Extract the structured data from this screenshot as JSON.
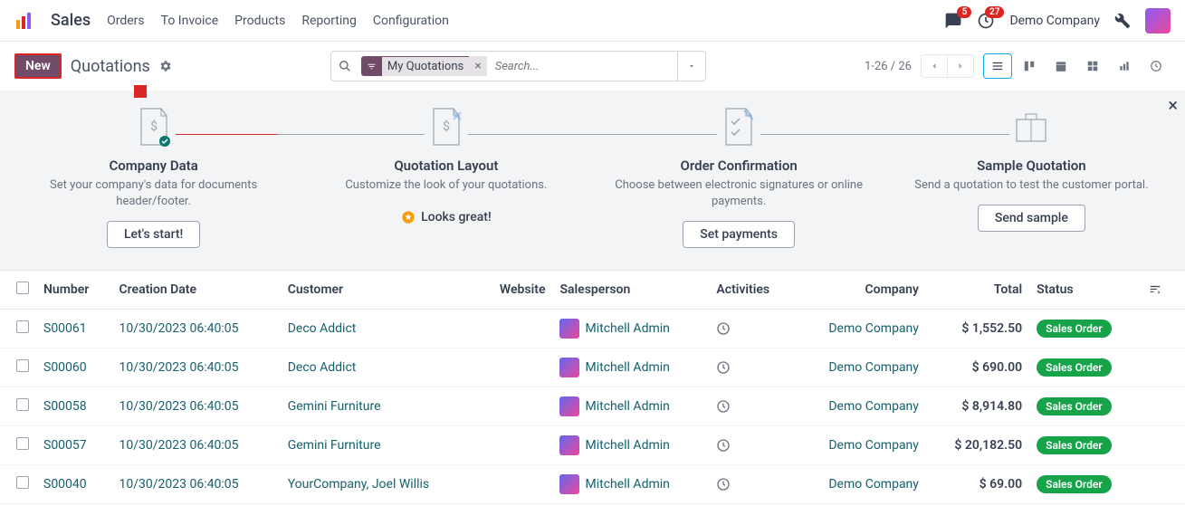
{
  "navbar": {
    "app_name": "Sales",
    "menu": [
      "Orders",
      "To Invoice",
      "Products",
      "Reporting",
      "Configuration"
    ],
    "chat_badge": "5",
    "activity_badge": "27",
    "company": "Demo Company"
  },
  "toolbar": {
    "new_label": "New",
    "breadcrumb": "Quotations",
    "filter_label": "My Quotations",
    "search_placeholder": "Search...",
    "pager": "1-26 / 26"
  },
  "onboarding": {
    "steps": [
      {
        "title": "Company Data",
        "desc": "Set your company's data for documents header/footer.",
        "btn": "Let's start!"
      },
      {
        "title": "Quotation Layout",
        "desc": "Customize the look of your quotations.",
        "btn": "Looks great!"
      },
      {
        "title": "Order Confirmation",
        "desc": "Choose between electronic signatures or online payments.",
        "btn": "Set payments"
      },
      {
        "title": "Sample Quotation",
        "desc": "Send a quotation to test the customer portal.",
        "btn": "Send sample"
      }
    ]
  },
  "table": {
    "headers": {
      "number": "Number",
      "creation": "Creation Date",
      "customer": "Customer",
      "website": "Website",
      "salesperson": "Salesperson",
      "activities": "Activities",
      "company": "Company",
      "total": "Total",
      "status": "Status"
    },
    "rows": [
      {
        "number": "S00061",
        "date": "10/30/2023 06:40:05",
        "customer": "Deco Addict",
        "salesperson": "Mitchell Admin",
        "company": "Demo Company",
        "total": "$ 1,552.50",
        "status": "Sales Order"
      },
      {
        "number": "S00060",
        "date": "10/30/2023 06:40:05",
        "customer": "Deco Addict",
        "salesperson": "Mitchell Admin",
        "company": "Demo Company",
        "total": "$ 690.00",
        "status": "Sales Order"
      },
      {
        "number": "S00058",
        "date": "10/30/2023 06:40:05",
        "customer": "Gemini Furniture",
        "salesperson": "Mitchell Admin",
        "company": "Demo Company",
        "total": "$ 8,914.80",
        "status": "Sales Order"
      },
      {
        "number": "S00057",
        "date": "10/30/2023 06:40:05",
        "customer": "Gemini Furniture",
        "salesperson": "Mitchell Admin",
        "company": "Demo Company",
        "total": "$ 20,182.50",
        "status": "Sales Order"
      },
      {
        "number": "S00040",
        "date": "10/30/2023 06:40:05",
        "customer": "YourCompany, Joel Willis",
        "salesperson": "Mitchell Admin",
        "company": "Demo Company",
        "total": "$ 69.00",
        "status": "Sales Order"
      }
    ]
  }
}
